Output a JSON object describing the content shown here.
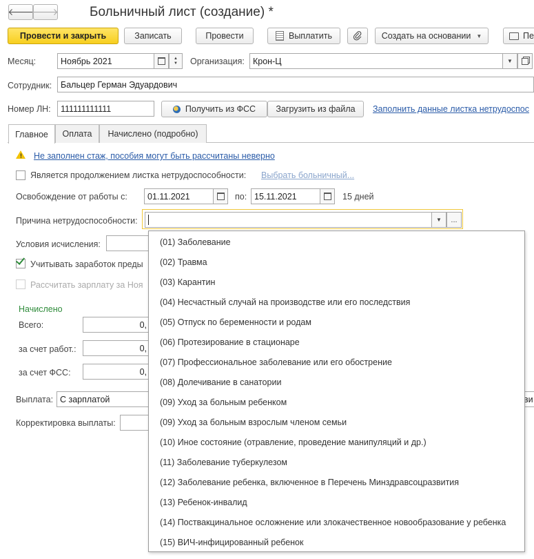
{
  "window": {
    "title": "Больничный лист (создание) *"
  },
  "nav": {
    "back": "🡐",
    "forward": "🡒"
  },
  "toolbar": {
    "post_close": "Провести и закрыть",
    "save": "Записать",
    "post": "Провести",
    "pay": "Выплатить",
    "create_based": "Создать на основании",
    "print": "Пе"
  },
  "form": {
    "month_label": "Месяц:",
    "month_value": "Ноябрь 2021",
    "org_label": "Организация:",
    "org_value": "Крон-Ц",
    "employee_label": "Сотрудник:",
    "employee_value": "Бальцер Герман Эдуардович",
    "ln_label": "Номер ЛН:",
    "ln_value": "111111111111",
    "get_fss": "Получить из ФСС",
    "load_file": "Загрузить из файла",
    "fill_link": "Заполнить данные листка нетрудоспос"
  },
  "tabs": [
    "Главное",
    "Оплата",
    "Начислено (подробно)"
  ],
  "main": {
    "warning": "Не заполнен стаж, пособия могут быть рассчитаны неверно",
    "continuation_label": "Является продолжением листка нетрудоспособности:",
    "choose_sick": "Выбрать больничный...",
    "release_label": "Освобождение от работы с:",
    "date_from": "01.11.2021",
    "to_label": "по:",
    "date_to": "15.11.2021",
    "days": "15 дней",
    "reason_label": "Причина нетрудоспособности:",
    "reason_value": "",
    "calc_conditions_label": "Условия исчисления:",
    "consider_earnings": "Учитывать заработок преды",
    "calc_salary": "Рассчитать зарплату за Ноя",
    "accrued_header": "Начислено",
    "total_label": "Всего:",
    "total_value": "0,",
    "employer_label": "за счет работ.:",
    "employer_value": "0,",
    "fss_label": "за счет ФСС:",
    "fss_value": "0,",
    "payment_label": "Выплата:",
    "payment_value": "С зарплатой",
    "payment_tail": "ви",
    "correction_label": "Корректировка выплаты:"
  },
  "dropdown": {
    "items": [
      "(01) Заболевание",
      "(02) Травма",
      "(03) Карантин",
      "(04) Несчастный случай на производстве или его последствия",
      "(05) Отпуск по беременности и родам",
      "(06) Протезирование в стационаре",
      "(07) Профессиональное заболевание или его обострение",
      "(08) Долечивание в санатории",
      "(09) Уход за больным ребенком",
      "(09) Уход за больным взрослым членом семьи",
      "(10) Иное состояние (отравление, проведение манипуляций и др.)",
      "(11) Заболевание туберкулезом",
      "(12) Заболевание ребенка, включенное в Перечень Минздравсоцразвития",
      "(13) Ребенок-инвалид",
      "(14) Поствакцинальное осложнение или злокачественное новообразование у ребенка",
      "(15) ВИЧ-инфицированный ребенок"
    ]
  },
  "colors": {
    "accent": "#f7cf1f",
    "link": "#2a5ba8",
    "accrued": "#2e8b3a"
  }
}
